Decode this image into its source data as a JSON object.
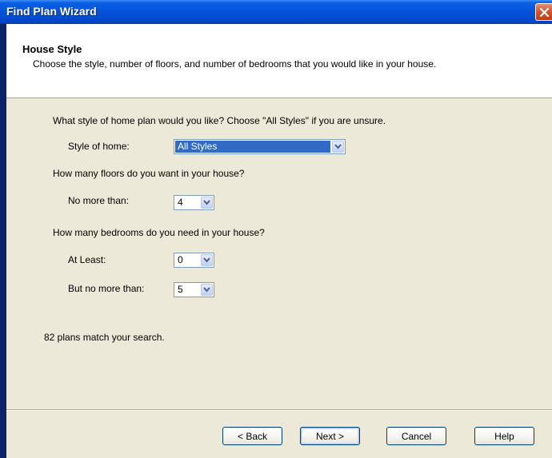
{
  "window": {
    "title": "Find Plan Wizard"
  },
  "header": {
    "title": "House Style",
    "description": "Choose the style, number of floors, and number of bedrooms that you would like in your house."
  },
  "questions": {
    "style": "What style of home plan would you like? Choose \"All Styles\" if you are unsure.",
    "floors": "How many floors do you want in your house?",
    "bedrooms": "How many bedrooms do you need in your house?"
  },
  "fields": {
    "style_label": "Style of home:",
    "style_value": "All Styles",
    "floors_label": "No more than:",
    "floors_value": "4",
    "bedrooms_min_label": "At Least:",
    "bedrooms_min_value": "0",
    "bedrooms_max_label": "But no more than:",
    "bedrooms_max_value": "5"
  },
  "status": {
    "match_text": "82 plans match your search."
  },
  "buttons": {
    "back": "< Back",
    "next": "Next >",
    "cancel": "Cancel",
    "help": "Help"
  }
}
